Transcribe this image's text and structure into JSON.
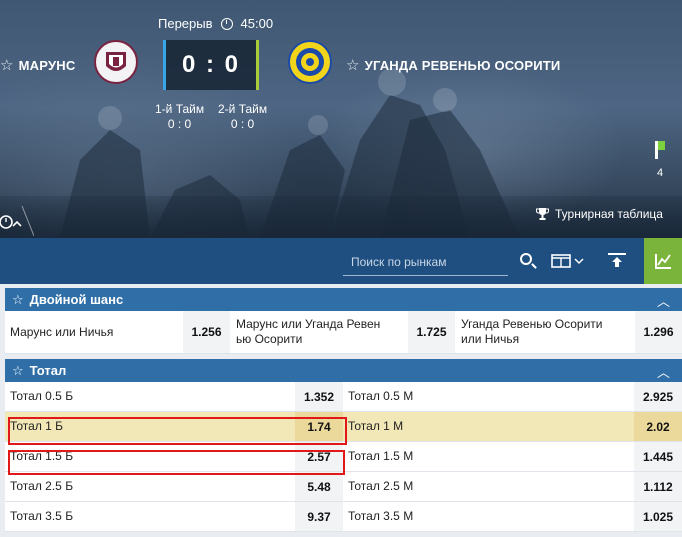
{
  "match": {
    "status": "Перерыв",
    "time": "45:00",
    "home": "МАРУНС",
    "away": "УГАНДА РЕВЕНЬЮ ОСОРИТИ",
    "score": "0 : 0",
    "half1_label": "1-й Тайм",
    "half1_score": "0 : 0",
    "half2_label": "2-й Тайм",
    "half2_score": "0 : 0",
    "side_count": "4",
    "tournament_link": "Турнирная таблица"
  },
  "toolbar": {
    "search_placeholder": "Поиск по рынкам"
  },
  "double_chance": {
    "title": "Двойной шанс",
    "outcomes": [
      {
        "label": "Марунс или Ничья",
        "odd": "1.256"
      },
      {
        "label": "Марунс или Уганда Ревеньюо Осорити",
        "line1": "Марунс или Уганда Ревен",
        "line2": "ью Осорити",
        "odd": "1.725"
      },
      {
        "label": "Уганда Ревенью Осорити или Ничья",
        "line1": "Уганда Ревенью Осорити",
        "line2": "или Ничья",
        "odd": "1.296"
      }
    ]
  },
  "total": {
    "title": "Тотал",
    "rows": [
      {
        "over": "Тотал 0.5 Б",
        "over_odd": "1.352",
        "under": "Тотал 0.5 М",
        "under_odd": "2.925"
      },
      {
        "over": "Тотал 1 Б",
        "over_odd": "1.74",
        "under": "Тотал 1 М",
        "under_odd": "2.02"
      },
      {
        "over": "Тотал 1.5 Б",
        "over_odd": "2.57",
        "under": "Тотал 1.5 М",
        "under_odd": "1.445"
      },
      {
        "over": "Тотал 2.5 Б",
        "over_odd": "5.48",
        "under": "Тотал 2.5 М",
        "under_odd": "1.112"
      },
      {
        "over": "Тотал 3.5 Б",
        "over_odd": "9.37",
        "under": "Тотал 3.5 М",
        "under_odd": "1.025"
      }
    ]
  },
  "colors": {
    "toolbar": "#1f4f80",
    "market_header": "#2f6ea6",
    "highlight_row": "#f2e7b6",
    "annotation_box": "#e01818",
    "stats_button": "#7ab43a"
  }
}
